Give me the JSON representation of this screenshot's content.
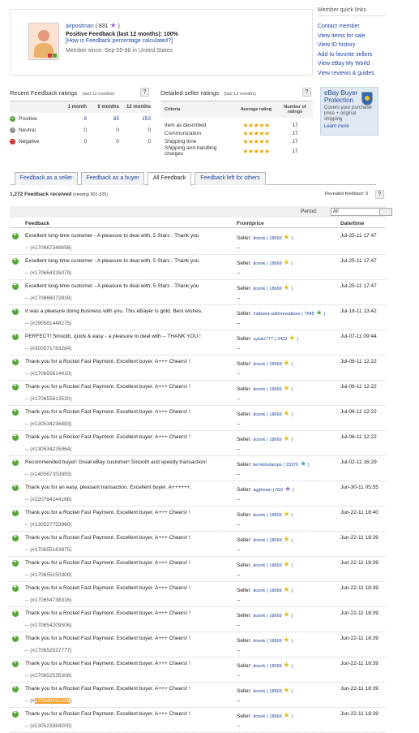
{
  "profile": {
    "username": "airpostman",
    "score_text": "( 831",
    "score_close": ")",
    "positive_feedback": "Positive Feedback (last 12 months): 100%",
    "how_calc": "[How is Feedback percentage calculated?]",
    "member_since": "Member since: Sep-05-98 in United States"
  },
  "quick_links": {
    "title": "Member quick links",
    "items": [
      "Contact member",
      "View items for sale",
      "View ID history",
      "Add to favorite sellers",
      "View eBay My World",
      "View reviews & guides"
    ]
  },
  "recent": {
    "title": "Recent Feedback ratings",
    "period": "(last 12 months)",
    "help": "?",
    "headers": [
      "1 month",
      "6 months",
      "12 months"
    ],
    "rows": [
      {
        "label": "Positive",
        "v": [
          "8",
          "65",
          "153"
        ]
      },
      {
        "label": "Neutral",
        "v": [
          "0",
          "0",
          "0"
        ]
      },
      {
        "label": "Negative",
        "v": [
          "0",
          "0",
          "0"
        ]
      }
    ]
  },
  "detailed": {
    "title": "Detailed seller ratings",
    "period": "(last 12 months)",
    "help": "?",
    "headers": {
      "criteria": "Criteria",
      "avg": "Average rating",
      "count": "Number of ratings"
    },
    "rows": [
      {
        "criteria": "Item as described",
        "stars": "★★★★★",
        "count": "17"
      },
      {
        "criteria": "Communication",
        "stars": "★★★★★",
        "count": "17"
      },
      {
        "criteria": "Shipping time",
        "stars": "★★★★★",
        "count": "17"
      },
      {
        "criteria": "Shipping and handling charges",
        "stars": "★★★★★",
        "count": "17"
      }
    ]
  },
  "buyer_protection": {
    "title": "eBay Buyer Protection",
    "desc": "Covers your purchase price + original shipping",
    "link": "Learn more"
  },
  "tabs": [
    "Feedback as a seller",
    "Feedback as a buyer",
    "All Feedback",
    "Feedback left for others"
  ],
  "count": {
    "text": "1,272 Feedback received",
    "viewing": "(viewing 301-325)",
    "revealed": "Revealed feedback: 0",
    "help": "?"
  },
  "period": {
    "label": "Period:",
    "value": "All"
  },
  "table_headers": {
    "feedback": "Feedback",
    "from": "From/price",
    "date": "Date/time"
  },
  "rows": [
    {
      "comment": "Excellent long-time customer - A pleasure to deal with, 5 Stars - Thank you",
      "num": "-- (#170667348656)",
      "seller": "doonk",
      "score": "( 18669",
      "star": "yellow",
      "date": "Jul-25-11 17:47"
    },
    {
      "comment": "Excellent long-time customer - A pleasure to deal with, 5 Stars - Thank you",
      "num": "-- (#170664335079)",
      "seller": "doonk",
      "score": "( 18669",
      "star": "yellow",
      "date": "Jul-25-11 17:47"
    },
    {
      "comment": "Excellent long-time customer - A pleasure to deal with, 5 Stars - Thank you",
      "num": "-- (#170666072839)",
      "seller": "doonk",
      "score": "( 18669",
      "star": "yellow",
      "date": "Jul-25-11 17:47"
    },
    {
      "comment": "It was a pleasure doing business with you. This eBayer is gold. Best wishes.",
      "num": "-- (#290581448275)",
      "seller": "midwest-sellinnovations",
      "score": "( 7645",
      "star": "green",
      "date": "Jul-18-11 13:42"
    },
    {
      "comment": "PERFECT! Smooth, quick & easy - a pleasure to deal with -- THANK YOU !",
      "num": "-- (#300571783284)",
      "seller": "sylsier777",
      "score": "( 3432",
      "star": "yellow",
      "date": "Jul-07-11 09:44"
    },
    {
      "comment": "Thank you for a Rocket Fast Payment. Excellent buyer. A+++ Cheers! !",
      "num": "-- (#170655614410)",
      "seller": "doonk",
      "score": "( 18669",
      "star": "yellow",
      "date": "Jul-06-11 12:22"
    },
    {
      "comment": "Thank you for a Rocket Fast Payment. Excellent buyer. A+++ Cheers! !",
      "num": "-- (#170655613530)",
      "seller": "doonk",
      "score": "( 18669",
      "star": "yellow",
      "date": "Jul-06-11 12:22"
    },
    {
      "comment": "Thank you for a Rocket Fast Payment. Excellent buyer. A+++ Cheers! !",
      "num": "-- (#130534236483)",
      "seller": "doonk",
      "score": "( 18669",
      "star": "yellow",
      "date": "Jul-06-11 12:22"
    },
    {
      "comment": "Thank you for a Rocket Fast Payment. Excellent buyer. A+++ Cheers! !",
      "num": "-- (#130534235964)",
      "seller": "doonk",
      "score": "( 18669",
      "star": "yellow",
      "date": "Jul-06-11 12:22"
    },
    {
      "comment": "Recommended buyer! Great eBay customer! Smooth and speedy transaction!",
      "num": "-- (#140567353993)",
      "seller": "bel-kirkstamps",
      "score": "( 23376",
      "star": "teal",
      "date": "Jul-02-11 16:29"
    },
    {
      "comment": "Thank you for an easy, pleasant transaction. Excellent buyer. A++++++.",
      "num": "-- (#220794244168)",
      "seller": "aggheian",
      "score": "( 552",
      "star": "purple",
      "date": "Jun-30-11 05:55"
    },
    {
      "comment": "Thank you for a Rocket Fast Payment. Excellent buyer. A+++ Cheers! !",
      "num": "-- (#130527753960)",
      "seller": "doonk",
      "score": "( 18669",
      "star": "yellow",
      "date": "Jun-22-11 18:40"
    },
    {
      "comment": "Thank you for a Rocket Fast Payment. Excellent buyer. A+++ Cheers! !",
      "num": "-- (#170655163875)",
      "seller": "doonk",
      "score": "( 18669",
      "star": "yellow",
      "date": "Jun-22-11 18:39"
    },
    {
      "comment": "Thank you for a Rocket Fast Payment. Excellent buyer. A+++ Cheers! !",
      "num": "-- (#170655150300)",
      "seller": "doonk",
      "score": "( 18669",
      "star": "yellow",
      "date": "Jun-22-11 18:39"
    },
    {
      "comment": "Thank you for a Rocket Fast Payment. Excellent buyer. A+++ Cheers! !",
      "num": "-- (#170654738316)",
      "seller": "doonk",
      "score": "( 18669",
      "star": "yellow",
      "date": "Jun-22-11 18:39"
    },
    {
      "comment": "Thank you for a Rocket Fast Payment. Excellent buyer. A+++ Cheers! !",
      "num": "-- (#170654209506)",
      "seller": "doonk",
      "score": "( 18669",
      "star": "yellow",
      "date": "Jun-22-11 18:39"
    },
    {
      "comment": "Thank you for a Rocket Fast Payment. Excellent buyer. A+++ Cheers! !",
      "num": "-- (#170652537777)",
      "seller": "doonk",
      "score": "( 18669",
      "star": "yellow",
      "date": "Jun-22-11 18:39"
    },
    {
      "comment": "Thank you for a Rocket Fast Payment. Excellent buyer. A+++ Cheers! !",
      "num": "-- (#170652535308)",
      "seller": "doonk",
      "score": "( 18669",
      "star": "yellow",
      "date": "Jun-22-11 18:39"
    },
    {
      "comment": "Thank you for a Rocket Fast Payment. Excellent buyer. A+++ Cheers! !",
      "num_prefix": "-- (#",
      "num_hl": "170649191009",
      "num_suffix": ")",
      "seller": "doonk",
      "score": "( 18669",
      "star": "yellow",
      "date": "Jun-22-11 18:39"
    },
    {
      "comment": "Thank you for a Rocket Fast Payment. Excellent buyer. A+++ Cheers! !",
      "num": "-- (#130523384200)",
      "seller": "doonk",
      "score": "( 18669",
      "star": "yellow",
      "date": "Jun-22-11 18:39"
    }
  ],
  "seller_prefix": "Seller:",
  "dash": "--"
}
